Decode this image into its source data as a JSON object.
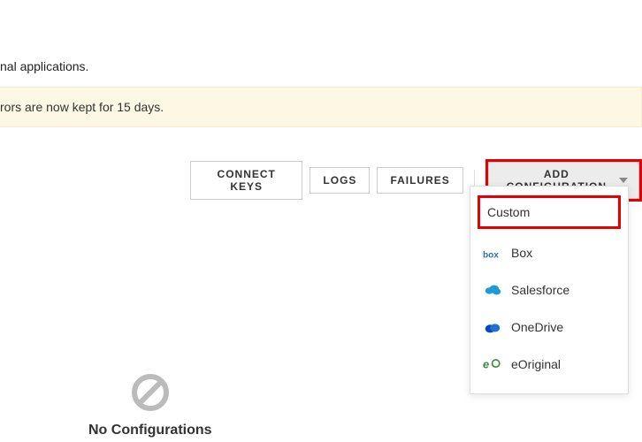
{
  "intro_fragment": "nal applications.",
  "alert_fragment": "rors are now kept for 15 days.",
  "toolbar": {
    "connect_keys": "CONNECT KEYS",
    "logs": "LOGS",
    "failures": "FAILURES",
    "add_configuration": "ADD CONFIGURATION"
  },
  "dropdown": {
    "items": [
      {
        "label": "Custom"
      },
      {
        "label": "Box"
      },
      {
        "label": "Salesforce"
      },
      {
        "label": "OneDrive"
      },
      {
        "label": "eOriginal"
      }
    ]
  },
  "empty_state": {
    "title": "No Configurations"
  }
}
